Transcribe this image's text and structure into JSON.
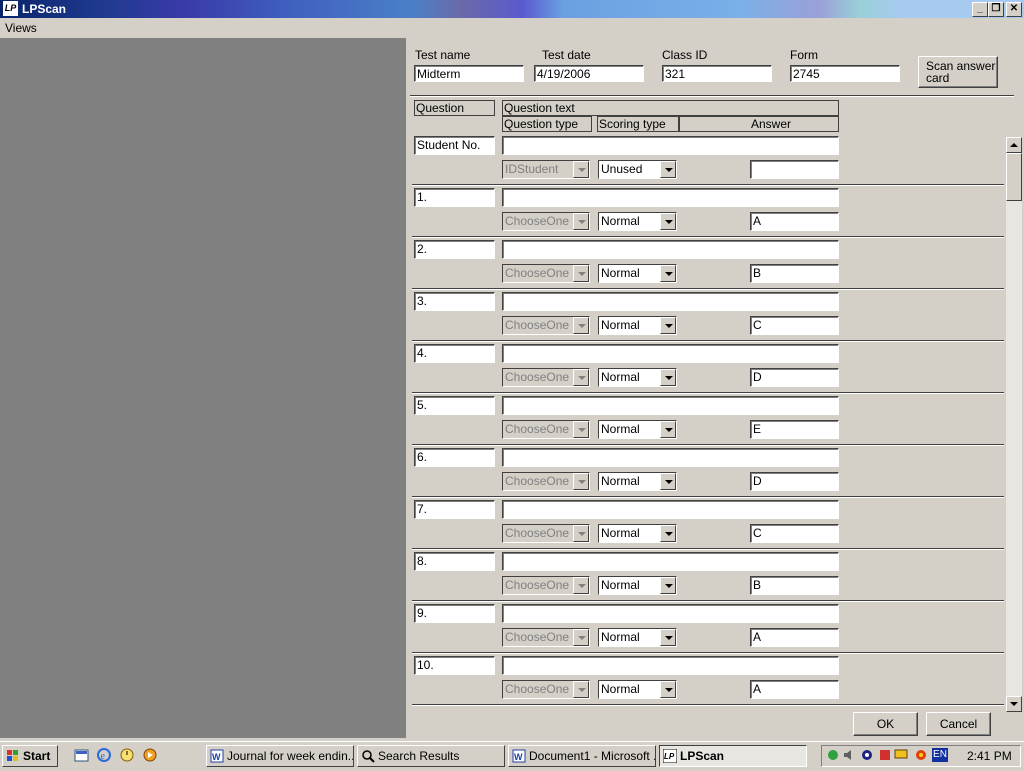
{
  "window": {
    "title": "LPScan"
  },
  "menu": {
    "views": "Views"
  },
  "header": {
    "test_name_label": "Test name",
    "test_name": "Midterm",
    "test_date_label": "Test date",
    "test_date": "4/19/2006",
    "class_id_label": "Class ID",
    "class_id": "321",
    "form_label": "Form",
    "form": "2745",
    "scan_button": "Scan answer card"
  },
  "columns": {
    "question": "Question",
    "question_text": "Question text",
    "question_type": "Question type",
    "scoring_type": "Scoring type",
    "answer": "Answer"
  },
  "rows": [
    {
      "question": "Student No.",
      "text": "",
      "qtype": "IDStudent",
      "scoring": "Unused",
      "answer": ""
    },
    {
      "question": "1.",
      "text": "",
      "qtype": "ChooseOne",
      "scoring": "Normal",
      "answer": "A"
    },
    {
      "question": "2.",
      "text": "",
      "qtype": "ChooseOne",
      "scoring": "Normal",
      "answer": "B"
    },
    {
      "question": "3.",
      "text": "",
      "qtype": "ChooseOne",
      "scoring": "Normal",
      "answer": "C"
    },
    {
      "question": "4.",
      "text": "",
      "qtype": "ChooseOne",
      "scoring": "Normal",
      "answer": "D"
    },
    {
      "question": "5.",
      "text": "",
      "qtype": "ChooseOne",
      "scoring": "Normal",
      "answer": "E"
    },
    {
      "question": "6.",
      "text": "",
      "qtype": "ChooseOne",
      "scoring": "Normal",
      "answer": "D"
    },
    {
      "question": "7.",
      "text": "",
      "qtype": "ChooseOne",
      "scoring": "Normal",
      "answer": "C"
    },
    {
      "question": "8.",
      "text": "",
      "qtype": "ChooseOne",
      "scoring": "Normal",
      "answer": "B"
    },
    {
      "question": "9.",
      "text": "",
      "qtype": "ChooseOne",
      "scoring": "Normal",
      "answer": "A"
    },
    {
      "question": "10.",
      "text": "",
      "qtype": "ChooseOne",
      "scoring": "Normal",
      "answer": "A"
    }
  ],
  "footer": {
    "ok": "OK",
    "cancel": "Cancel"
  },
  "taskbar": {
    "start": "Start",
    "tasks": [
      "Journal for week endin...",
      "Search Results",
      "Document1 - Microsoft ...",
      "LPScan"
    ],
    "lang": "EN",
    "clock": "2:41 PM"
  }
}
